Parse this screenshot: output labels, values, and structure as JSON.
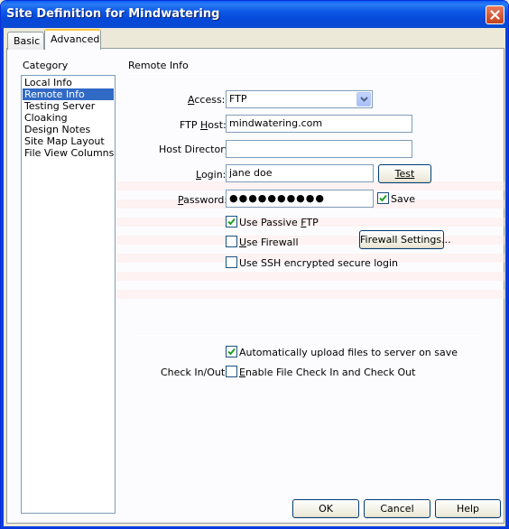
{
  "window": {
    "title": "Site Definition for Mindwatering"
  },
  "tabs": [
    {
      "label": "Basic",
      "active": false
    },
    {
      "label": "Advanced",
      "active": true
    }
  ],
  "category": {
    "heading": "Category",
    "items": [
      "Local Info",
      "Remote Info",
      "Testing Server",
      "Cloaking",
      "Design Notes",
      "Site Map Layout",
      "File View Columns"
    ],
    "selected": "Remote Info"
  },
  "section": {
    "title": "Remote Info"
  },
  "form": {
    "access": {
      "label": "Access:",
      "value": "FTP"
    },
    "ftp_host": {
      "label": "FTP Host:",
      "value": "mindwatering.com"
    },
    "host_directory": {
      "label": "Host Directory:",
      "value": ""
    },
    "login": {
      "label": "Login:",
      "value": "jane doe"
    },
    "password": {
      "label": "Password:",
      "masked_value": "●●●●●●●●●●"
    },
    "test_button": "Test",
    "save_checkbox": {
      "label": "Save",
      "checked": true
    },
    "use_passive_ftp": {
      "label": "Use Passive FTP",
      "checked": true
    },
    "use_firewall": {
      "label": "Use Firewall",
      "checked": false
    },
    "firewall_settings_button": "Firewall Settings...",
    "use_ssh": {
      "label": "Use SSH encrypted secure login",
      "checked": false
    },
    "auto_upload": {
      "label": "Automatically upload files to server on save",
      "checked": true
    },
    "check_in_out": {
      "label": "Check In/Out:"
    },
    "enable_checkin": {
      "label": "Enable File Check In and Check Out",
      "checked": false
    }
  },
  "footer": {
    "ok": "OK",
    "cancel": "Cancel",
    "help": "Help"
  },
  "colors": {
    "titlebar": "#0b58e6",
    "selection": "#316ac5",
    "dialog_bg": "#ece9d8",
    "close_button": "#c4421c"
  }
}
